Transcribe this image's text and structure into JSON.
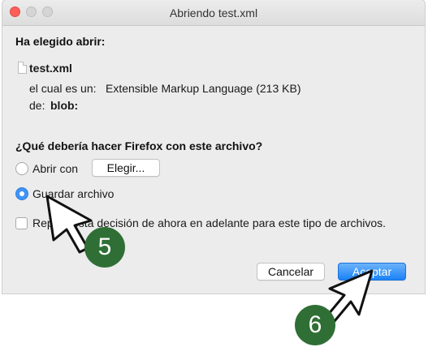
{
  "window": {
    "title": "Abriendo test.xml"
  },
  "section1": {
    "heading": "Ha elegido abrir:",
    "file_name": "test.xml",
    "type_label": "el cual es un:",
    "type_value": "Extensible Markup Language (213 KB)",
    "from_label": "de:",
    "from_value": "blob:"
  },
  "section2": {
    "heading": "¿Qué debería hacer Firefox con este archivo?",
    "open_with_label": "Abrir con",
    "choose_button": "Elegir...",
    "save_file_label": "Guardar archivo",
    "save_file_selected": true,
    "remember_label": "Repetir esta decisión de ahora en adelante para este tipo de archivos.",
    "remember_checked": false
  },
  "buttons": {
    "cancel": "Cancelar",
    "accept": "Aceptar"
  },
  "annotations": {
    "step5": "5",
    "step6": "6",
    "badge_color": "#2f6f35"
  },
  "colors": {
    "accent": "#1b82f6",
    "close_button": "#fc5f57"
  }
}
